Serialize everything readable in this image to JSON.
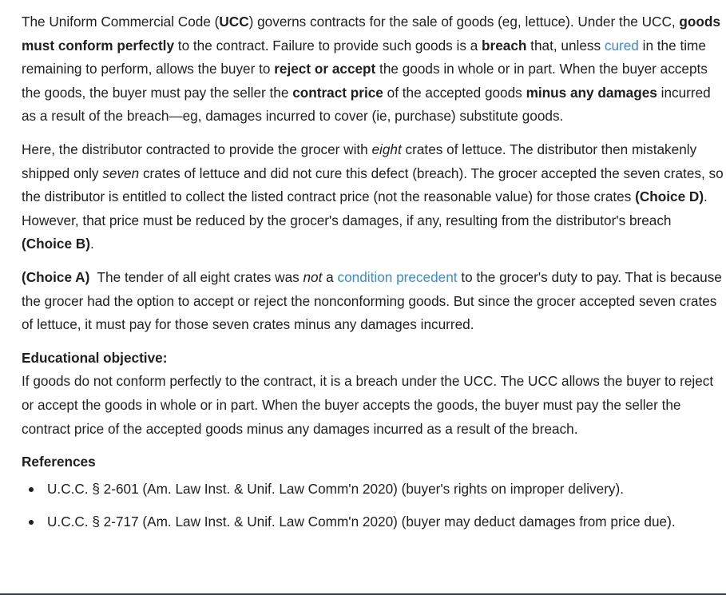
{
  "para1": {
    "s1": "The Uniform Commercial Code (",
    "s2": "UCC",
    "s3": ") governs contracts for the sale of goods (eg, lettuce).  Under the UCC, ",
    "s4": "goods must conform perfectly",
    "s5": " to the contract.  Failure to provide such goods is a ",
    "s6": "breach",
    "s7": " that, unless ",
    "s8_link": "cured",
    "s9": " in the time remaining to perform, allows the buyer to ",
    "s10": "reject or accept",
    "s11": " the goods in whole or in part.  When the buyer accepts the goods, the buyer must pay the seller the ",
    "s12": "contract price",
    "s13": " of the accepted goods ",
    "s14": "minus any damages",
    "s15": " incurred as a result of the breach—eg, damages incurred to cover (ie, purchase) substitute goods."
  },
  "para2": {
    "s1": "Here, the distributor contracted to provide the grocer with ",
    "s2": "eight",
    "s3": " crates of lettuce.  The distributor then mistakenly shipped only ",
    "s4": "seven",
    "s5": " crates of lettuce and did not cure this defect (breach).  The grocer accepted the seven crates, so the distributor is entitled to collect the listed contract price (not the reasonable value) for those crates ",
    "s6": "(Choice D)",
    "s7": ".  However, that price must be reduced by the grocer's damages, if any, resulting from the distributor's breach ",
    "s8": "(Choice B)",
    "s9": "."
  },
  "para3": {
    "s1": "(Choice A)",
    "s2": "  The tender of all eight crates was ",
    "s3": "not",
    "s4": " a ",
    "s5_link": "condition precedent",
    "s6": " to the grocer's duty to pay.  That is because the grocer had the option to accept or reject the nonconforming goods.  But since the grocer accepted seven crates of lettuce, it must pay for those seven crates minus any damages incurred."
  },
  "educational": {
    "heading": "Educational objective:",
    "body": "If goods do not conform perfectly to the contract, it is a breach under the UCC.  The UCC allows the buyer to reject or accept the goods in whole or in part.  When the buyer accepts the goods, the buyer must pay the seller the contract price of the accepted goods minus any damages incurred as a result of the breach."
  },
  "references": {
    "heading": "References",
    "items": [
      "U.C.C. § 2-601 (Am. Law Inst. & Unif. Law Comm'n 2020) (buyer's rights on improper delivery).",
      "U.C.C. § 2-717 (Am. Law Inst. & Unif. Law Comm'n 2020) (buyer may deduct damages from price due)."
    ]
  },
  "colors": {
    "text": "#1f1f1f",
    "link": "#3b8ad8",
    "rule": "#2c3e50"
  }
}
